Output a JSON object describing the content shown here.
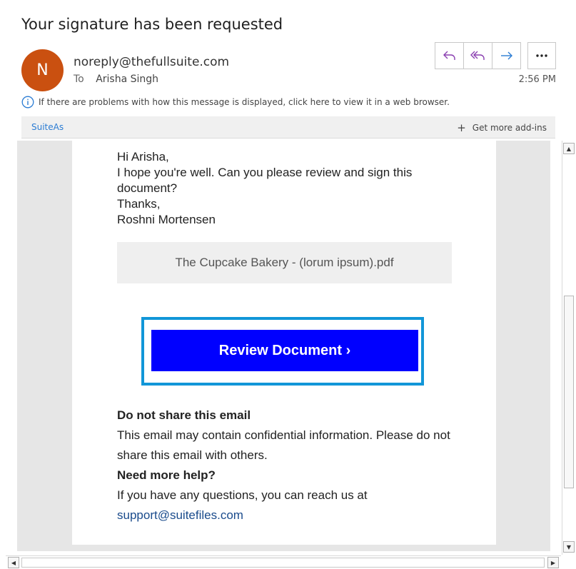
{
  "message": {
    "subject": "Your signature has been requested",
    "avatar_initial": "N",
    "sender": "noreply@thefullsuite.com",
    "to_label": "To",
    "recipient": "Arisha Singh",
    "time": "2:56 PM",
    "info_text": "If there are problems with how this message is displayed, click here to view it in a web browser."
  },
  "addins": {
    "suiteas_label": "SuiteAs",
    "more_addins_label": "Get more add-ins"
  },
  "body": {
    "lines": [
      "Hi Arisha,",
      "I hope you're well. Can you please review and sign this document?",
      "Thanks,",
      "Roshni Mortensen"
    ],
    "attachment_name": "The Cupcake Bakery - (lorum ipsum).pdf",
    "cta_label": "Review Document ›",
    "share_heading": "Do not share this email",
    "share_text": "This email may contain confidential information. Please do not share this email with others.",
    "help_heading": "Need more help?",
    "help_text": "If you have any questions, you can reach us at",
    "support_email": "support@suitefiles.com"
  },
  "icons": {
    "reply": "reply-icon",
    "reply_all": "reply-all-icon",
    "forward": "forward-icon",
    "more": "more-icon",
    "info": "info-icon",
    "add": "plus-icon"
  },
  "colors": {
    "avatar": "#ca5010",
    "cta_button": "#0000ff",
    "cta_outline": "#1196d8",
    "link": "#2b7cd3"
  }
}
